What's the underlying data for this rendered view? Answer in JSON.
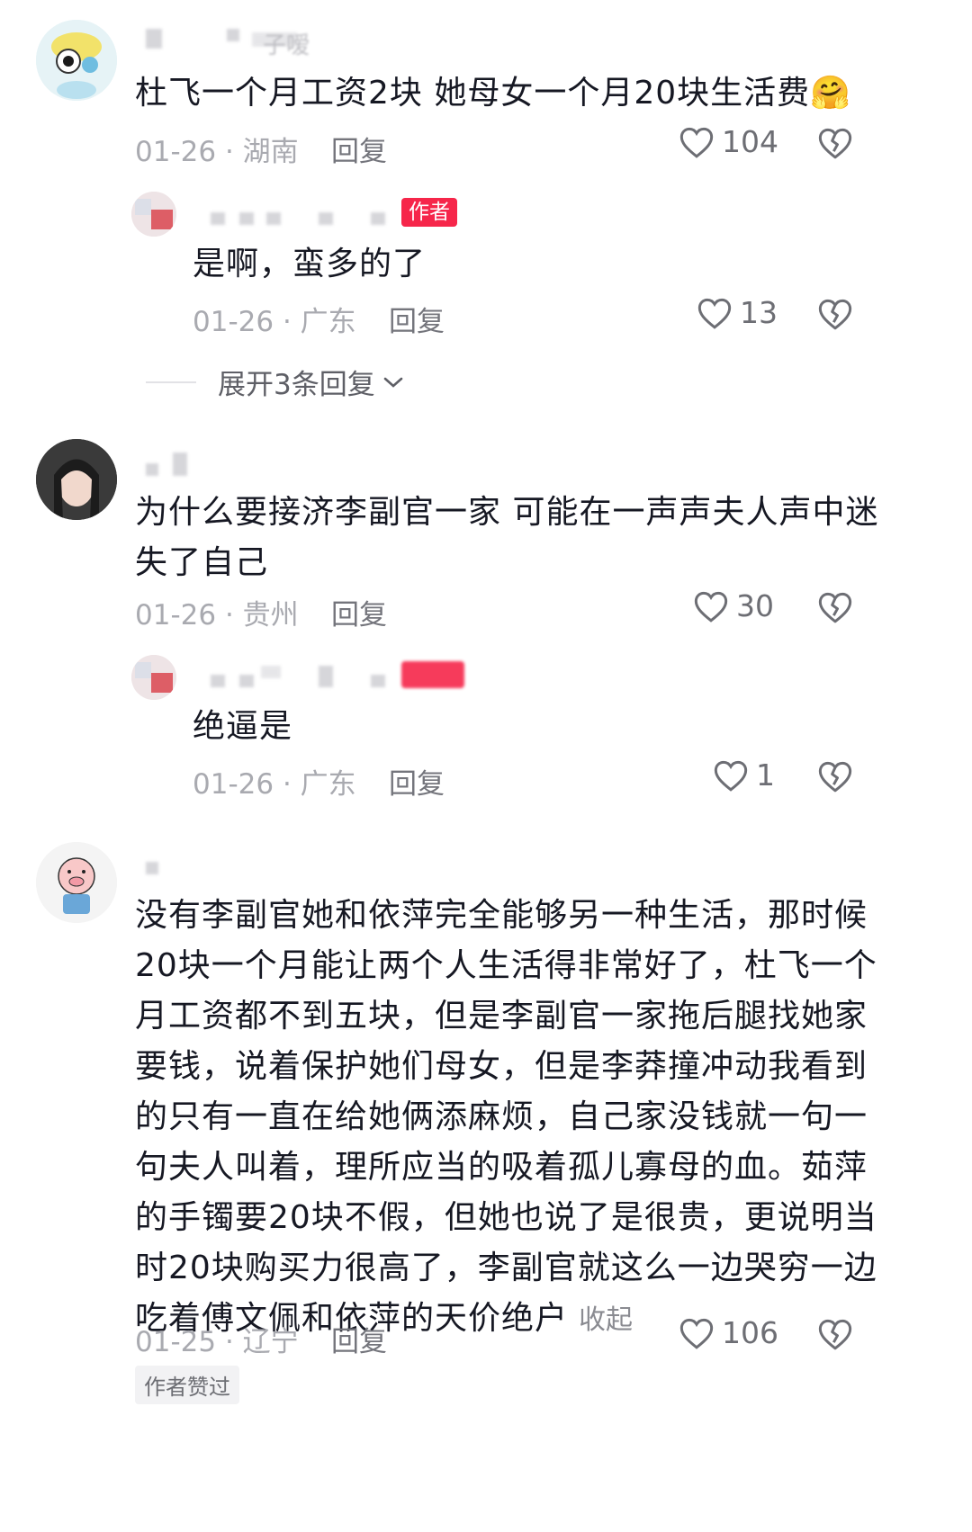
{
  "comments": [
    {
      "username_tail": "子嗳",
      "text": "杜飞一个月工资2块 她母女一个月20块生活费",
      "emoji": "🤗",
      "date": "01-26",
      "location": "湖南",
      "reply_label": "回复",
      "likes": "104",
      "replies": [
        {
          "badge": "作者",
          "text": "是啊，蛮多的了",
          "date": "01-26",
          "location": "广东",
          "reply_label": "回复",
          "likes": "13"
        }
      ],
      "expand_label": "展开3条回复"
    },
    {
      "text_line1": "为什么要接济李副官一家 可能在一声声夫人声中迷",
      "text_line2": "失了自己",
      "date": "01-26",
      "location": "贵州",
      "reply_label": "回复",
      "likes": "30",
      "replies": [
        {
          "text": "绝逼是",
          "date": "01-26",
          "location": "广东",
          "reply_label": "回复",
          "likes": "1"
        }
      ]
    },
    {
      "lines": [
        "没有李副官她和依萍完全能够另一种生活，那时候",
        "20块一个月能让两个人生活得非常好了，杜飞一个",
        "月工资都不到五块，但是李副官一家拖后腿找她家",
        "要钱，说着保护她们母女，但是李莽撞冲动我看到",
        "的只有一直在给她俩添麻烦，自己家没钱就一句一",
        "句夫人叫着，理所应当的吸着孤儿寡母的血。茹萍",
        "的手镯要20块不假，但她也说了是很贵，更说明当",
        "时20块购买力很高了，李副官就这么一边哭穷一边",
        "吃着傅文佩和依萍的天价绝户"
      ],
      "collapse_label": "收起",
      "date": "01-25",
      "location": "辽宁",
      "reply_label": "回复",
      "likes": "106",
      "liked_tag": "作者赞过"
    }
  ],
  "separator": "·"
}
